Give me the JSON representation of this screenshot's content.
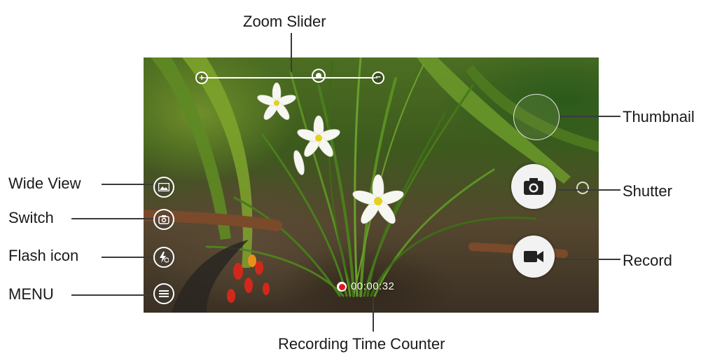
{
  "labels": {
    "zoom_slider": "Zoom Slider",
    "thumbnail": "Thumbnail",
    "shutter": "Shutter",
    "record": "Record",
    "wide_view": "Wide View",
    "switch": "Switch",
    "flash_icon": "Flash icon",
    "menu": "MENU",
    "recording_time_counter": "Recording Time Counter"
  },
  "camera": {
    "recording_time": "00:00:32"
  },
  "icons": {
    "zoom_in": "zoom-in-icon",
    "zoom_out": "zoom-out-icon",
    "zoom_thumb": "zoom-slider-thumb",
    "wide_view": "wide-view-icon",
    "switch": "camera-switch-icon",
    "flash": "flash-icon",
    "menu": "menu-icon",
    "shutter": "camera-icon",
    "record": "video-camera-icon",
    "recording": "recording-dot-icon"
  },
  "colors": {
    "recording_dot": "#e3161b",
    "control_stroke": "#ffffff",
    "leader_line": "#3a3a3a"
  }
}
